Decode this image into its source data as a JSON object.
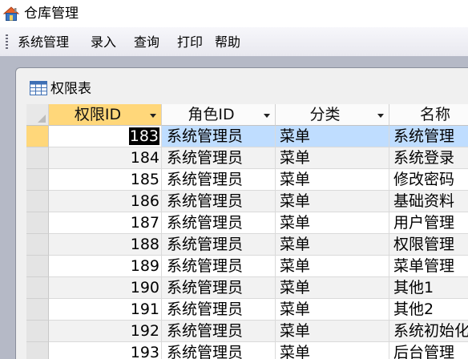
{
  "app": {
    "title": "仓库管理",
    "icon": "house-icon"
  },
  "menu": [
    {
      "label": "系统管理"
    },
    {
      "label": "录入"
    },
    {
      "label": "查询"
    },
    {
      "label": "打印"
    },
    {
      "label": "帮助"
    }
  ],
  "form": {
    "title": "权限表",
    "icon": "table-icon"
  },
  "grid": {
    "columns": [
      "权限ID",
      "角色ID",
      "分类",
      "名称"
    ],
    "current_row": 0,
    "rows": [
      [
        "183",
        "系统管理员",
        "菜单",
        "系统管理"
      ],
      [
        "184",
        "系统管理员",
        "菜单",
        "系统登录"
      ],
      [
        "185",
        "系统管理员",
        "菜单",
        "修改密码"
      ],
      [
        "186",
        "系统管理员",
        "菜单",
        "基础资料"
      ],
      [
        "187",
        "系统管理员",
        "菜单",
        "用户管理"
      ],
      [
        "188",
        "系统管理员",
        "菜单",
        "权限管理"
      ],
      [
        "189",
        "系统管理员",
        "菜单",
        "菜单管理"
      ],
      [
        "190",
        "系统管理员",
        "菜单",
        "其他1"
      ],
      [
        "191",
        "系统管理员",
        "菜单",
        "其他2"
      ],
      [
        "192",
        "系统管理员",
        "菜单",
        "系统初始化"
      ],
      [
        "193",
        "系统管理员",
        "菜单",
        "后台管理"
      ]
    ]
  },
  "colors": {
    "accent_header": "#ffd77a",
    "selection": "#bfddff",
    "mdi_background": "#b5b9c6"
  }
}
